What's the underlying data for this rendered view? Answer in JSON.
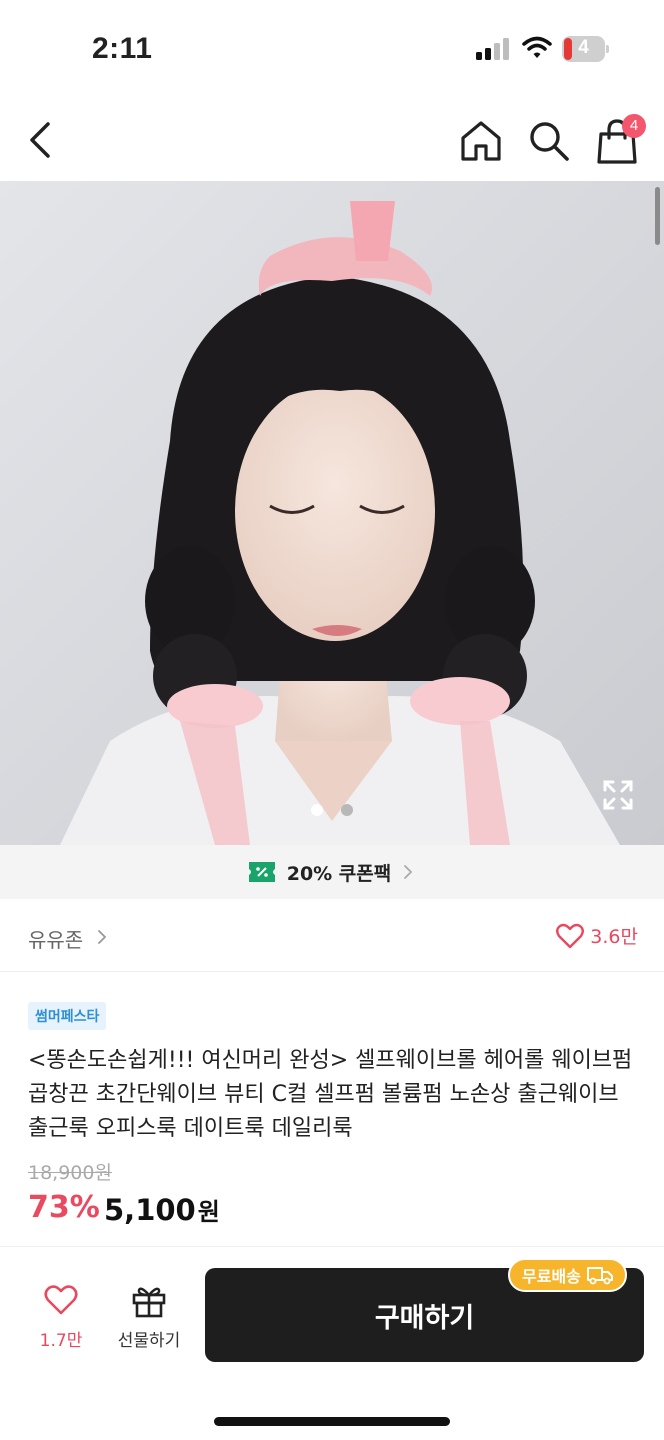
{
  "status_bar": {
    "time": "2:11",
    "battery_level": "4"
  },
  "nav": {
    "cart_count": "4"
  },
  "hero": {
    "slide_count": 2,
    "active_slide": 1
  },
  "coupon": {
    "label": "20% 쿠폰팩"
  },
  "store": {
    "name": "유유존",
    "like_count": "3.6만"
  },
  "product": {
    "tag": "썸머페스타",
    "title": "<똥손도손쉽게!!! 여신머리 완성> 셀프웨이브롤 헤어롤 웨이브펌 곱창끈 초간단웨이브 뷰티 C컬 셀프펌 볼륨펌 노손상 출근웨이브 출근룩 오피스룩 데이트룩 데일리룩",
    "original_price": "18,900원",
    "discount": "73%",
    "price": "5,100",
    "currency": "원"
  },
  "bottom_bar": {
    "like_count": "1.7만",
    "gift_label": "선물하기",
    "buy_label": "구매하기",
    "free_shipping_label": "무료배송"
  },
  "colors": {
    "accent_pink": "#ea4a5f",
    "badge_pink": "#f4566e",
    "tag_blue": "#2f8fd6",
    "free_ship_yellow": "#f7b52c",
    "buy_button": "#1e1e1e"
  },
  "icons": [
    "back-icon",
    "home-icon",
    "search-icon",
    "cart-icon",
    "expand-icon",
    "coupon-icon",
    "heart-icon",
    "gift-icon",
    "truck-icon"
  ]
}
